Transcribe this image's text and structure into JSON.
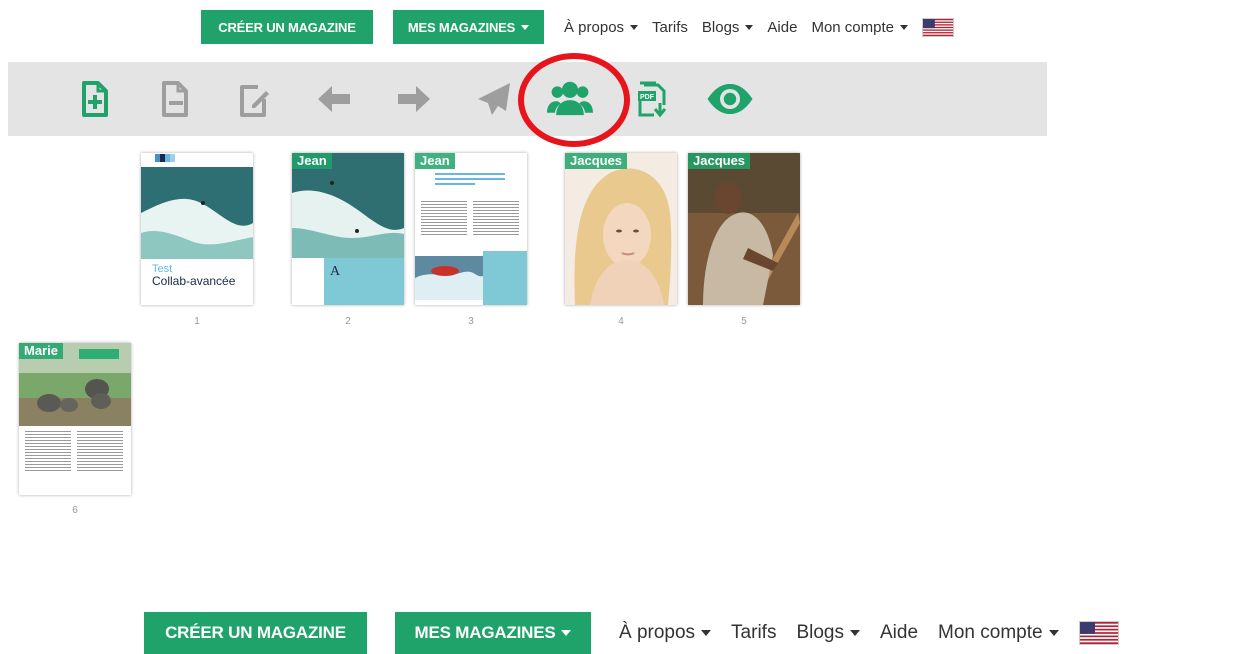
{
  "nav": {
    "create_label": "CRÉER UN MAGAZINE",
    "my_magazines_label": "MES MAGAZINES",
    "about_label": "À propos",
    "pricing_label": "Tarifs",
    "blogs_label": "Blogs",
    "help_label": "Aide",
    "account_label": "Mon compte",
    "flag_icon": "us-flag-icon"
  },
  "toolbar": {
    "icons": [
      "add-page-icon",
      "remove-page-icon",
      "edit-page-icon",
      "arrow-left-icon",
      "arrow-right-icon",
      "send-icon",
      "users-icon",
      "pdf-download-icon",
      "eye-icon"
    ]
  },
  "pages": [
    {
      "number": "1",
      "author": "",
      "title": "Test",
      "subtitle": "Collab-avancée"
    },
    {
      "number": "2",
      "author": "Jean"
    },
    {
      "number": "3",
      "author": "Jean"
    },
    {
      "number": "4",
      "author": "Jacques"
    },
    {
      "number": "5",
      "author": "Jacques"
    },
    {
      "number": "6",
      "author": "Marie"
    }
  ],
  "colors": {
    "accent": "#1fa36a",
    "toolbar_bg": "#e4e4e4",
    "highlight_circle": "#e8141b",
    "disabled_icon": "#9e9e9e"
  }
}
